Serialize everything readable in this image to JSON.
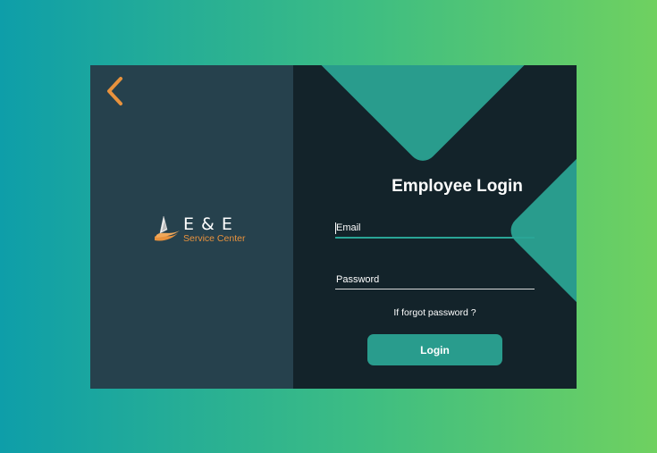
{
  "logo": {
    "title": "E & E",
    "subtitle": "Service Center"
  },
  "form": {
    "heading": "Employee Login",
    "email_placeholder": "Email",
    "password_placeholder": "Password",
    "forgot_text": "If forgot password ?",
    "login_label": "Login"
  },
  "icons": {
    "back": "chevron-left-icon",
    "logo_mark": "wave-boat-icon"
  },
  "colors": {
    "background_gradient_start": "#0e9ea9",
    "background_gradient_end": "#6fd160",
    "left_panel": "#26414d",
    "right_panel": "#13232a",
    "accent": "#299c8d",
    "back_icon": "#e8923d",
    "logo_subtitle": "#e8923d"
  }
}
